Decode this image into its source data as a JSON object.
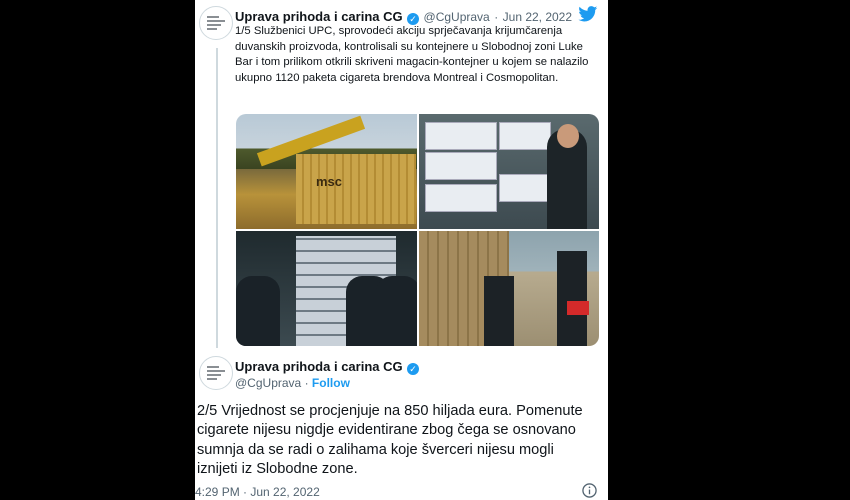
{
  "tweet1": {
    "name": "Uprava prihoda i carina CG",
    "handle": "@CgUprava",
    "separator": "·",
    "date": "Jun 22, 2022",
    "text": "1/5 Službenici UPC, sprovodeći akciju sprječavanja krijumčarenja duvanskih proizvoda, kontrolisali su kontejnere u Slobodnoj zoni Luke Bar i tom prilikom otkrili skriveni magacin-kontejner u kojem se nalazilo ukupno 1120 paketa cigareta brendova Montreal i Cosmopolitan.",
    "container_logo": "msc"
  },
  "tweet2": {
    "name": "Uprava prihoda i carina CG",
    "handle": "@CgUprava",
    "separator": "·",
    "follow_label": "Follow",
    "text": "2/5 Vrijednost se procjenjuje na 850 hiljada eura. Pomenute cigarete nijesu nigdje evidentirane zbog čega se osnovano sumnja da se radi o zalihama koje šverceri nijesu mogli iznijeti iz Slobodne zone.",
    "timestamp": "4:29 PM · Jun 22, 2022"
  },
  "icons": {
    "verified": "verified-badge-icon",
    "twitter": "twitter-bird-icon",
    "info": "info-icon"
  },
  "colors": {
    "twitter_blue": "#1d9bf0",
    "text": "#0f1419",
    "muted": "#536471",
    "background": "#000000"
  }
}
